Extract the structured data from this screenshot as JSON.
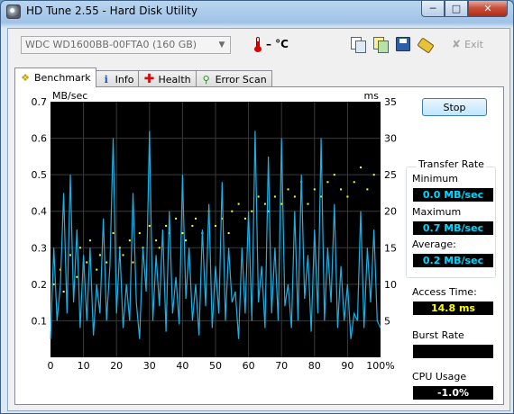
{
  "window": {
    "title": "HD Tune 2.55 - Hard Disk Utility"
  },
  "toolbar": {
    "drive": "WDC WD1600BB-00FTA0 (160 GB)",
    "temperature": "– °C",
    "exit_label": "Exit",
    "icons": [
      "copy-text-icon",
      "copy-screenshot-icon",
      "save-icon",
      "options-icon",
      "exit-icon"
    ]
  },
  "tabs": [
    {
      "label": "Benchmark",
      "icon": "benchmark-icon",
      "active": true
    },
    {
      "label": "Info",
      "icon": "info-icon"
    },
    {
      "label": "Health",
      "icon": "health-icon"
    },
    {
      "label": "Error Scan",
      "icon": "error-scan-icon"
    }
  ],
  "benchmark": {
    "stop_label": "Stop",
    "transfer_rate_title": "Transfer Rate",
    "minimum_label": "Minimum",
    "minimum_value": "0.0 MB/sec",
    "maximum_label": "Maximum",
    "maximum_value": "0.7 MB/sec",
    "average_label": "Average:",
    "average_value": "0.2 MB/sec",
    "access_time_label": "Access Time:",
    "access_time_value": "14.8 ms",
    "burst_rate_label": "Burst Rate",
    "burst_rate_value": "",
    "cpu_usage_label": "CPU Usage",
    "cpu_usage_value": "-1.0%"
  },
  "colors": {
    "plot_background": "#000000",
    "grid": "#3a3a3a",
    "transfer_line": "#1ab2e6",
    "access_points": "#ffff33",
    "value_cyan": "#00d8ff",
    "value_yellow": "#ffff00"
  },
  "chart_data": {
    "type": "line",
    "ylabel": "MB/sec",
    "y2label": "ms",
    "ylim": [
      0,
      0.7
    ],
    "y2lim": [
      0,
      35
    ],
    "xlim": [
      0,
      100
    ],
    "x_ticks": [
      "0",
      "10",
      "20",
      "30",
      "40",
      "50",
      "60",
      "70",
      "80",
      "90",
      "100%"
    ],
    "y_ticks": [
      "0.1",
      "0.2",
      "0.3",
      "0.4",
      "0.5",
      "0.6",
      "0.7"
    ],
    "y2_ticks": [
      "5",
      "10",
      "15",
      "20",
      "25",
      "30",
      "35"
    ],
    "grid": true,
    "series": [
      {
        "name": "Transfer Rate",
        "x": [
          0,
          1,
          2,
          3,
          4,
          5,
          6,
          7,
          8,
          9,
          10,
          11,
          12,
          13,
          14,
          15,
          16,
          17,
          18,
          19,
          20,
          21,
          22,
          23,
          24,
          25,
          26,
          27,
          28,
          29,
          30,
          31,
          32,
          33,
          34,
          35,
          36,
          37,
          38,
          39,
          40,
          41,
          42,
          43,
          44,
          45,
          46,
          47,
          48,
          49,
          50,
          51,
          52,
          53,
          54,
          55,
          56,
          57,
          58,
          59,
          60,
          61,
          62,
          63,
          64,
          65,
          66,
          67,
          68,
          69,
          70,
          71,
          72,
          73,
          74,
          75,
          76,
          77,
          78,
          79,
          80,
          81,
          82,
          83,
          84,
          85,
          86,
          87,
          88,
          89,
          90,
          91,
          92,
          93,
          94,
          95,
          96,
          97,
          98,
          99,
          100
        ],
        "values": [
          0.05,
          0.3,
          0.1,
          0.2,
          0.45,
          0.12,
          0.5,
          0.15,
          0.35,
          0.08,
          0.28,
          0.1,
          0.3,
          0.06,
          0.2,
          0.12,
          0.38,
          0.1,
          0.25,
          0.6,
          0.12,
          0.3,
          0.08,
          0.2,
          0.1,
          0.45,
          0.15,
          0.05,
          0.3,
          0.18,
          0.62,
          0.1,
          0.28,
          0.14,
          0.35,
          0.07,
          0.4,
          0.12,
          0.22,
          0.09,
          0.5,
          0.16,
          0.3,
          0.1,
          0.2,
          0.06,
          0.35,
          0.14,
          0.42,
          0.08,
          0.25,
          0.12,
          0.48,
          0.1,
          0.3,
          0.15,
          0.18,
          0.05,
          0.3,
          0.12,
          0.4,
          0.1,
          0.62,
          0.15,
          0.25,
          0.08,
          0.55,
          0.12,
          0.3,
          0.1,
          0.6,
          0.14,
          0.2,
          0.08,
          0.4,
          0.1,
          0.5,
          0.16,
          0.28,
          0.07,
          0.35,
          0.12,
          0.6,
          0.1,
          0.3,
          0.15,
          0.42,
          0.08,
          0.25,
          0.1,
          0.2,
          0.05,
          0.12,
          0.1,
          0.4,
          0.08,
          0.3,
          0.15,
          0.35,
          0.1,
          0.08
        ]
      },
      {
        "name": "Access Time",
        "x": [
          1,
          3,
          4,
          6,
          8,
          9,
          11,
          12,
          14,
          15,
          17,
          19,
          21,
          22,
          24,
          25,
          27,
          28,
          30,
          32,
          33,
          35,
          36,
          38,
          40,
          41,
          43,
          44,
          46,
          48,
          50,
          52,
          54,
          55,
          57,
          59,
          61,
          63,
          65,
          66,
          68,
          70,
          72,
          74,
          76,
          78,
          80,
          82,
          84,
          86,
          88,
          90,
          92,
          94,
          96,
          98
        ],
        "values": [
          10,
          12,
          9,
          14,
          11,
          15,
          13,
          16,
          12,
          14,
          13,
          17,
          15,
          14,
          16,
          13,
          17,
          15,
          18,
          16,
          15,
          18,
          17,
          19,
          17,
          16,
          18,
          19,
          17,
          20,
          18,
          19,
          17,
          20,
          21,
          19,
          20,
          22,
          21,
          20,
          22,
          21,
          23,
          22,
          24,
          21,
          23,
          22,
          24,
          25,
          23,
          22,
          24,
          26,
          23,
          25
        ]
      }
    ]
  }
}
